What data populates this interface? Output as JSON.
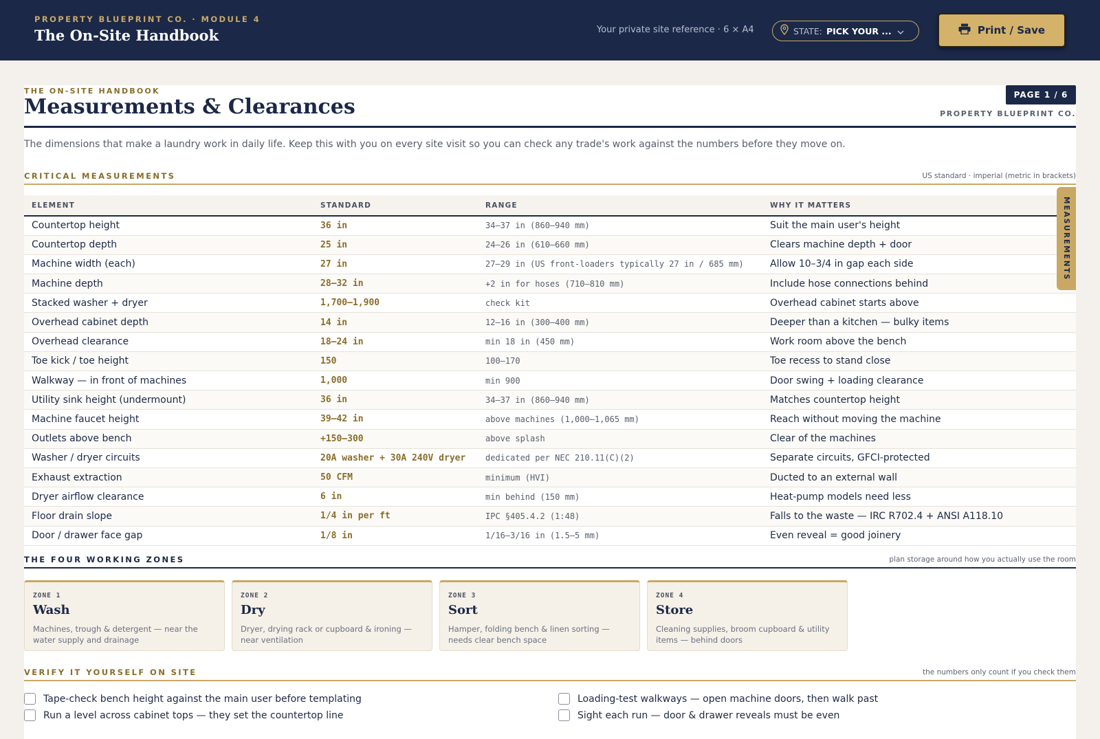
{
  "header": {
    "kicker": "PROPERTY BLUEPRINT CO. · MODULE 4",
    "title": "The On-Site Handbook",
    "reference": "Your private site reference · 6 × A4",
    "state_label": "STATE:",
    "state_value": "PICK YOUR ...",
    "print_label": "Print / Save"
  },
  "page": {
    "kicker": "THE ON-SITE HANDBOOK",
    "title": "Measurements & Clearances",
    "badge": "PAGE 1 / 6",
    "company": "PROPERTY BLUEPRINT CO.",
    "intro": "The dimensions that make a laundry work in daily life. Keep this with you on every site visit so you can check any trade's work against the numbers before they move on."
  },
  "critical": {
    "title": "CRITICAL MEASUREMENTS",
    "note": "US standard · imperial (metric in brackets)",
    "columns": [
      "ELEMENT",
      "STANDARD",
      "RANGE",
      "WHY IT MATTERS"
    ],
    "side_tab": "MEASUREMENTS",
    "rows": [
      [
        "Countertop height",
        "36 in",
        "34–37 in (860–940 mm)",
        "Suit the main user's height"
      ],
      [
        "Countertop depth",
        "25 in",
        "24–26 in (610–660 mm)",
        "Clears machine depth + door"
      ],
      [
        "Machine width (each)",
        "27 in",
        "27–29 in (US front-loaders typically 27 in / 685 mm)",
        "Allow 10–3/4 in gap each side"
      ],
      [
        "Machine depth",
        "28–32 in",
        "+2 in for hoses (710–810 mm)",
        "Include hose connections behind"
      ],
      [
        "Stacked washer + dryer",
        "1,700–1,900",
        "check kit",
        "Overhead cabinet starts above"
      ],
      [
        "Overhead cabinet depth",
        "14 in",
        "12–16 in (300–400 mm)",
        "Deeper than a kitchen — bulky items"
      ],
      [
        "Overhead clearance",
        "18–24 in",
        "min 18 in (450 mm)",
        "Work room above the bench"
      ],
      [
        "Toe kick / toe height",
        "150",
        "100–170",
        "Toe recess to stand close"
      ],
      [
        "Walkway — in front of machines",
        "1,000",
        "min 900",
        "Door swing + loading clearance"
      ],
      [
        "Utility sink height (undermount)",
        "36 in",
        "34–37 in (860–940 mm)",
        "Matches countertop height"
      ],
      [
        "Machine faucet height",
        "39–42 in",
        "above machines (1,000–1,065 mm)",
        "Reach without moving the machine"
      ],
      [
        "Outlets above bench",
        "+150–300",
        "above splash",
        "Clear of the machines"
      ],
      [
        "Washer / dryer circuits",
        "20A washer + 30A 240V dryer",
        "dedicated per NEC 210.11(C)(2)",
        "Separate circuits, GFCI-protected"
      ],
      [
        "Exhaust extraction",
        "50 CFM",
        "minimum (HVI)",
        "Ducted to an external wall"
      ],
      [
        "Dryer airflow clearance",
        "6 in",
        "min behind (150 mm)",
        "Heat-pump models need less"
      ],
      [
        "Floor drain slope",
        "1/4 in per ft",
        "IPC §405.4.2 (1:48)",
        "Falls to the waste — IRC R702.4 + ANSI A118.10"
      ],
      [
        "Door / drawer face gap",
        "1/8 in",
        "1/16–3/16 in (1.5–5 mm)",
        "Even reveal = good joinery"
      ]
    ]
  },
  "zones": {
    "title": "THE FOUR WORKING ZONES",
    "note": "plan storage around how you actually use the room",
    "items": [
      {
        "kicker": "ZONE 1",
        "name": "Wash",
        "desc": "Machines, trough & detergent — near the water supply and drainage"
      },
      {
        "kicker": "ZONE 2",
        "name": "Dry",
        "desc": "Dryer, drying rack or cupboard & ironing — near ventilation"
      },
      {
        "kicker": "ZONE 3",
        "name": "Sort",
        "desc": "Hamper, folding bench & linen sorting — needs clear bench space"
      },
      {
        "kicker": "ZONE 4",
        "name": "Store",
        "desc": "Cleaning supplies, broom cupboard & utility items — behind doors"
      }
    ]
  },
  "verify": {
    "title": "VERIFY IT YOURSELF ON SITE",
    "note": "the numbers only count if you check them",
    "items": [
      "Tape-check bench height against the main user before templating",
      "Loading-test walkways — open machine doors, then walk past",
      "Run a level across cabinet tops — they set the countertop line",
      "Sight each run — door & drawer reveals must be even"
    ]
  },
  "icons": {
    "state": "map-pin-icon",
    "chevron": "chevron-down-icon",
    "print": "printer-icon"
  },
  "colors": {
    "navy": "#1b2847",
    "gold": "#c9a865",
    "gold_dark": "#8a6d2a"
  }
}
